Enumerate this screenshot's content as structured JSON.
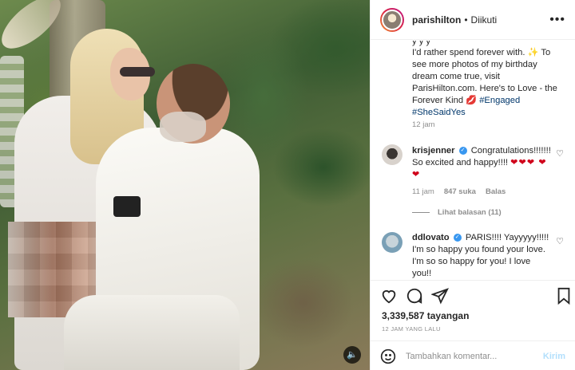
{
  "post": {
    "username": "parishilton",
    "follow_status": "Diikuti",
    "more_label": "•••",
    "caption_line_partial": "y  y             y",
    "caption_text": "I'd rather spend forever with. ✨ To see more photos of my birthday dream come true, visit ParisHilton.com. Here's to Love - the Forever Kind 💋",
    "caption_tag1": "#Engaged",
    "caption_tag2": "#SheSaidYes",
    "caption_time": "12 jam"
  },
  "comments": [
    {
      "username": "krisjenner",
      "text": "Congratulations!!!!!!! So excited and happy!!!! ",
      "hearts": "❤❤❤ ❤❤",
      "time": "11 jam",
      "likes": "847 suka",
      "reply_label": "Balas",
      "view_replies": "Lihat balasan (11)"
    },
    {
      "username": "ddlovato",
      "text": "PARIS!!!! Yayyyyy!!!!! I'm so happy you found your love. I'm so so happy for you! I love you!!"
    }
  ],
  "actions": {
    "views": "3,339,587 tayangan",
    "date": "12 JAM YANG LALU"
  },
  "add_comment": {
    "placeholder": "Tambahkan komentar...",
    "post_label": "Kirim"
  },
  "colors": {
    "link": "#00376b",
    "verified": "#3897f0",
    "heart": "#d0021b",
    "post_disabled": "#b2dffc"
  },
  "icons": [
    "speaker-icon",
    "more-icon",
    "heart-icon",
    "comment-icon",
    "share-icon",
    "bookmark-icon",
    "emoji-icon",
    "verified-icon"
  ]
}
